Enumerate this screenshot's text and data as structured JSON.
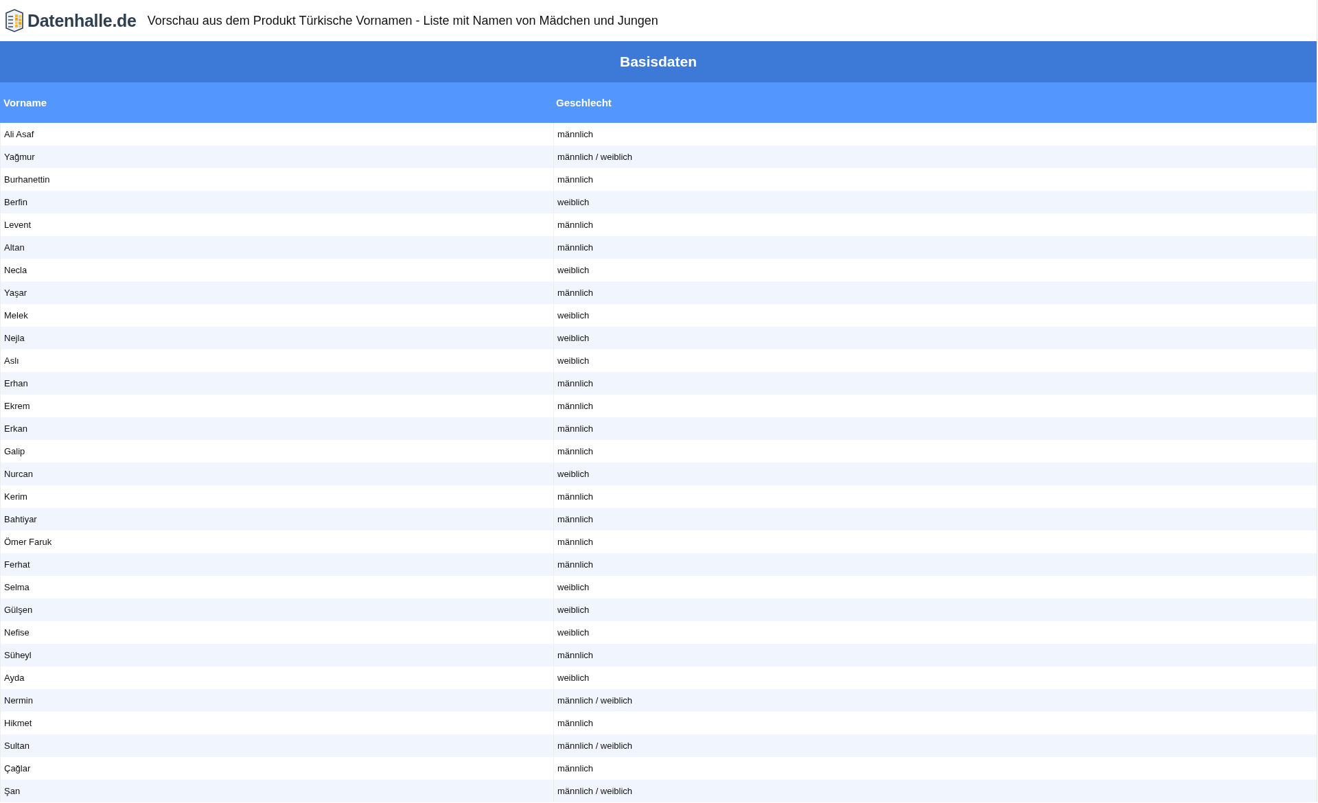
{
  "header": {
    "logo_text": "Datenhalle.de",
    "title": "Vorschau aus dem Produkt Türkische Vornamen - Liste mit Namen von Mädchen und Jungen"
  },
  "section": {
    "title": "Basisdaten"
  },
  "table": {
    "columns": [
      "Vorname",
      "Geschlecht"
    ],
    "rows": [
      [
        "Ali Asaf",
        "männlich"
      ],
      [
        "Yağmur",
        "männlich / weiblich"
      ],
      [
        "Burhanettin",
        "männlich"
      ],
      [
        "Berfin",
        "weiblich"
      ],
      [
        "Levent",
        "männlich"
      ],
      [
        "Altan",
        "männlich"
      ],
      [
        "Necla",
        "weiblich"
      ],
      [
        "Yaşar",
        "männlich"
      ],
      [
        "Melek",
        "weiblich"
      ],
      [
        "Nejla",
        "weiblich"
      ],
      [
        "Aslı",
        "weiblich"
      ],
      [
        "Erhan",
        "männlich"
      ],
      [
        "Ekrem",
        "männlich"
      ],
      [
        "Erkan",
        "männlich"
      ],
      [
        "Galip",
        "männlich"
      ],
      [
        "Nurcan",
        "weiblich"
      ],
      [
        "Kerim",
        "männlich"
      ],
      [
        "Bahtiyar",
        "männlich"
      ],
      [
        "Ömer Faruk",
        "männlich"
      ],
      [
        "Ferhat",
        "männlich"
      ],
      [
        "Selma",
        "weiblich"
      ],
      [
        "Gülşen",
        "weiblich"
      ],
      [
        "Nefise",
        "weiblich"
      ],
      [
        "Süheyl",
        "männlich"
      ],
      [
        "Ayda",
        "weiblich"
      ],
      [
        "Nermin",
        "männlich / weiblich"
      ],
      [
        "Hikmet",
        "männlich"
      ],
      [
        "Sultan",
        "männlich / weiblich"
      ],
      [
        "Çağlar",
        "männlich"
      ],
      [
        "Şan",
        "männlich / weiblich"
      ]
    ]
  }
}
